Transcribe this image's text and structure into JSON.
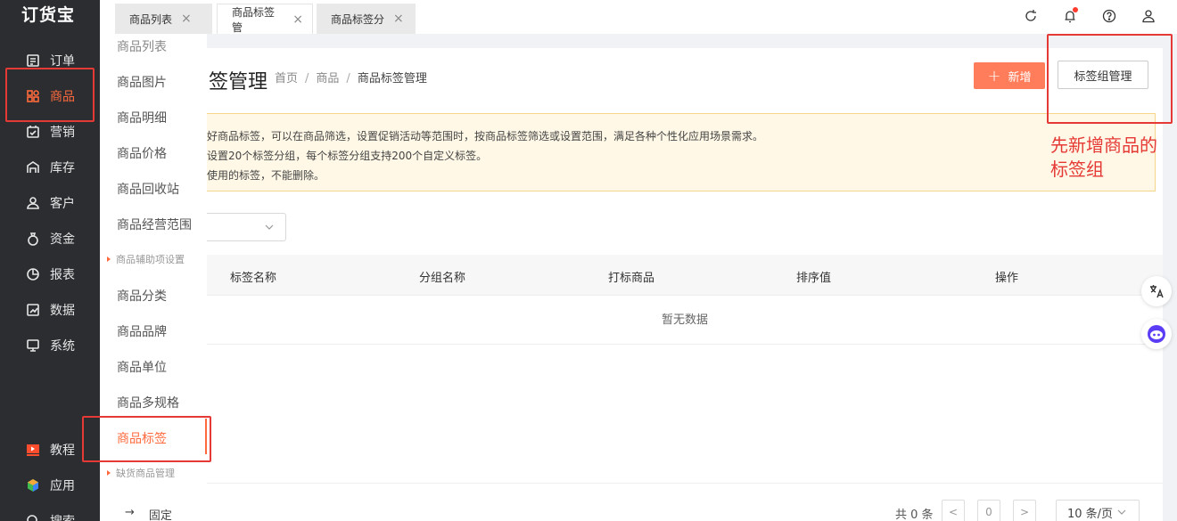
{
  "app": {
    "logo": "订货宝"
  },
  "sidebar": {
    "items": [
      {
        "label": "订单",
        "icon": "order-icon"
      },
      {
        "label": "商品",
        "icon": "goods-icon",
        "active": true
      },
      {
        "label": "营销",
        "icon": "marketing-icon"
      },
      {
        "label": "库存",
        "icon": "warehouse-icon"
      },
      {
        "label": "客户",
        "icon": "customer-icon"
      },
      {
        "label": "资金",
        "icon": "money-bag-icon"
      },
      {
        "label": "报表",
        "icon": "pie-chart-icon"
      },
      {
        "label": "数据",
        "icon": "data-icon"
      },
      {
        "label": "系统",
        "icon": "monitor-icon"
      }
    ],
    "bottom": [
      {
        "label": "教程",
        "icon": "video-icon"
      },
      {
        "label": "应用",
        "icon": "cube-icon"
      },
      {
        "label": "搜索",
        "icon": "search-icon"
      }
    ]
  },
  "submenu": {
    "items": [
      "商品列表",
      "商品图片",
      "商品明细",
      "商品价格",
      "商品回收站",
      "商品经营范围"
    ],
    "group1": "商品辅助项设置",
    "items2": [
      "商品分类",
      "商品品牌",
      "商品单位",
      "商品多规格",
      "商品标签"
    ],
    "group2": "缺货商品管理",
    "pin": "固定",
    "pin_arrow": "→"
  },
  "tabs": [
    {
      "label": "商品列表",
      "close": "×"
    },
    {
      "label": "商品标签管",
      "close": "×",
      "active": true
    },
    {
      "label": "商品标签分",
      "close": "×"
    }
  ],
  "page": {
    "title": "签管理",
    "breadcrumb": [
      "首页",
      "商品",
      "商品标签管理"
    ],
    "breadcrumb_sep": "/",
    "add_button": "新增",
    "add_plus": "+",
    "group_button": "标签组管理"
  },
  "notice": {
    "lines": [
      "好商品标签，可以在商品筛选，设置促销活动等范围时，按商品标签筛选或设置范围，满足各种个性化应用场景需求。",
      "设置20个标签分组，每个标签分组支持200个自定义标签。",
      "使用的标签，不能删除。"
    ]
  },
  "table": {
    "columns": [
      "标签名称",
      "分组名称",
      "打标商品",
      "排序值",
      "操作"
    ],
    "empty_text": "暂无数据"
  },
  "pager": {
    "total": "共 0 条",
    "prev": "<",
    "page": "0",
    "next": ">",
    "page_size": "10 条/页"
  },
  "annotation": {
    "text_line1": "先新增商品的",
    "text_line2": "标签组"
  },
  "colors": {
    "accent": "#ff6a3d",
    "annotation": "#e53935",
    "sidebar": "#2b2d31"
  }
}
